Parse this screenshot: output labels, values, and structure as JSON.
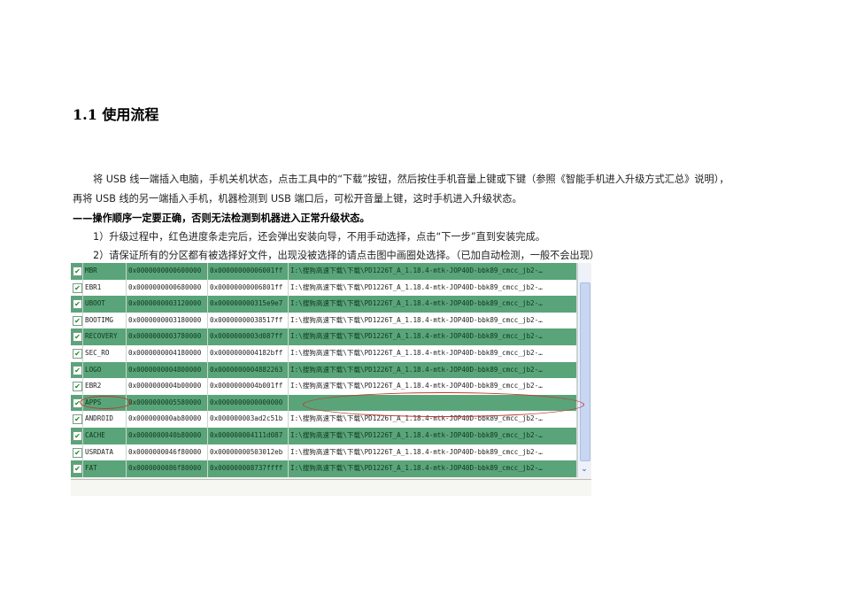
{
  "heading": "1.1 使用流程",
  "paragraphs": {
    "p1": "将 USB 线一端插入电脑，手机关机状态，点击工具中的“下载”按钮，然后按住手机音量上键或下键（参照《智能手机进入升级方式汇总》说明），",
    "p2": "再将 USB 线的另一端插入手机，机器检测到 USB 端口后，可松开音量上键，这时手机进入升级状态。",
    "warning": "——操作顺序一定要正确，否则无法检测到机器进入正常升级状态。",
    "step1": "1）升级过程中，红色进度条走完后，还会弹出安装向导，不用手动选择，点击“下一步”直到安装完成。",
    "step2": "2）请保证所有的分区都有被选择好文件，出现没被选择的请点击图中画圈处选择。（已加自动检测，一般不会出现）"
  },
  "partition_table": {
    "rows": [
      {
        "name": "MBR",
        "start": "0x0000000000600000",
        "end": "0x00000000006001ff",
        "path": "I:\\搜狗高速下载\\下载\\PD1226T_A_1.18.4-mtk-JOP40D-bbk89_cmcc_jb2-…",
        "checked": true
      },
      {
        "name": "EBR1",
        "start": "0x0000000000680000",
        "end": "0x00000000006801ff",
        "path": "I:\\搜狗高速下载\\下载\\PD1226T_A_1.18.4-mtk-JOP40D-bbk89_cmcc_jb2-…",
        "checked": true
      },
      {
        "name": "UBOOT",
        "start": "0x0000000003120000",
        "end": "0x000000000315e9e7",
        "path": "I:\\搜狗高速下载\\下载\\PD1226T_A_1.18.4-mtk-JOP40D-bbk89_cmcc_jb2-…",
        "checked": true
      },
      {
        "name": "BOOTIMG",
        "start": "0x0000000003180000",
        "end": "0x00000000038517ff",
        "path": "I:\\搜狗高速下载\\下载\\PD1226T_A_1.18.4-mtk-JOP40D-bbk89_cmcc_jb2-…",
        "checked": true
      },
      {
        "name": "RECOVERY",
        "start": "0x0000000003780000",
        "end": "0x0000000003d087ff",
        "path": "I:\\搜狗高速下载\\下载\\PD1226T_A_1.18.4-mtk-JOP40D-bbk89_cmcc_jb2-…",
        "checked": true
      },
      {
        "name": "SEC_RO",
        "start": "0x0000000004180000",
        "end": "0x0000000004182bff",
        "path": "I:\\搜狗高速下载\\下载\\PD1226T_A_1.18.4-mtk-JOP40D-bbk89_cmcc_jb2-…",
        "checked": true
      },
      {
        "name": "LOGO",
        "start": "0x0000000004800000",
        "end": "0x0000000004882263",
        "path": "I:\\搜狗高速下载\\下载\\PD1226T_A_1.18.4-mtk-JOP40D-bbk89_cmcc_jb2-…",
        "checked": true
      },
      {
        "name": "EBR2",
        "start": "0x0000000004b00000",
        "end": "0x0000000004b001ff",
        "path": "I:\\搜狗高速下载\\下载\\PD1226T_A_1.18.4-mtk-JOP40D-bbk89_cmcc_jb2-…",
        "checked": true
      },
      {
        "name": "APPS",
        "start": "0x0000000005580000",
        "end": "0x0000000000000000",
        "path": "",
        "checked": true
      },
      {
        "name": "ANDROID",
        "start": "0x000000000ab80000",
        "end": "0x000000003ad2c51b",
        "path": "I:\\搜狗高速下载\\下载\\PD1226T_A_1.18.4-mtk-JOP40D-bbk89_cmcc_jb2-…",
        "checked": true
      },
      {
        "name": "CACHE",
        "start": "0x0000000040b80000",
        "end": "0x000000004111d087",
        "path": "I:\\搜狗高速下载\\下载\\PD1226T_A_1.18.4-mtk-JOP40D-bbk89_cmcc_jb2-…",
        "checked": true
      },
      {
        "name": "USRDATA",
        "start": "0x0000000046f80000",
        "end": "0x00000000503012eb",
        "path": "I:\\搜狗高速下载\\下载\\PD1226T_A_1.18.4-mtk-JOP40D-bbk89_cmcc_jb2-…",
        "checked": true
      },
      {
        "name": "FAT",
        "start": "0x0000000086f80000",
        "end": "0x000000008737ffff",
        "path": "I:\\搜狗高速下载\\下载\\PD1226T_A_1.18.4-mtk-JOP40D-bbk89_cmcc_jb2-…",
        "checked": true
      }
    ]
  }
}
